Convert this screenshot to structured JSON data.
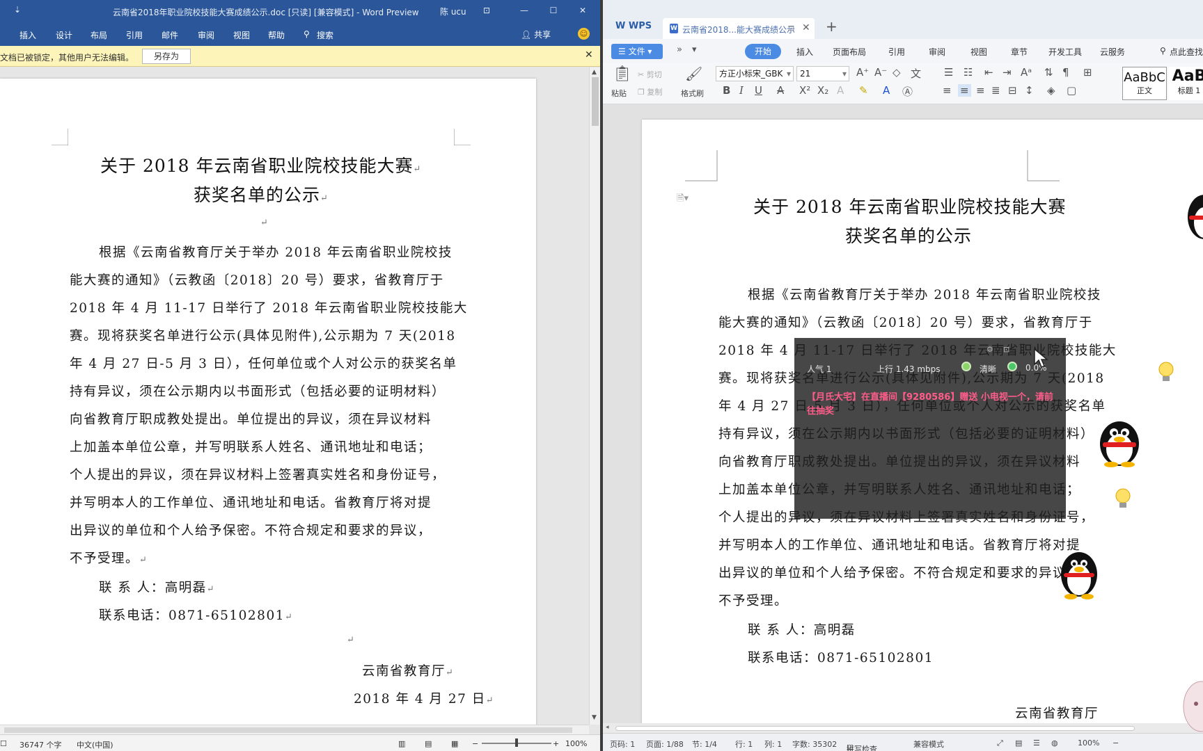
{
  "word": {
    "title": "云南省2018年职业院校技能大赛成绩公示.doc [只读] [兼容模式] - Word Preview",
    "user": "陈 ucu",
    "qa_symbol": "⇣",
    "ribbon_tabs": [
      "插入",
      "设计",
      "布局",
      "引用",
      "邮件",
      "审阅",
      "视图",
      "帮助",
      "搜索"
    ],
    "share_label": "共享",
    "infobar_message": "文档已被锁定，其他用户无法编辑。",
    "infobar_button": "另存为",
    "status": {
      "word_count": "36747 个字",
      "language": "中文(中国)",
      "zoom": "100%"
    }
  },
  "document": {
    "title_line1": "关于 2018 年云南省职业院校技能大赛",
    "title_line2": "获奖名单的公示",
    "paragraph_lines": [
      "根据《云南省教育厅关于举办 2018 年云南省职业院校技",
      "能大赛的通知》（云教函〔2018〕20 号）要求，省教育厅于",
      "2018 年 4 月 11-17 日举行了 2018 年云南省职业院校技能大",
      "赛。现将获奖名单进行公示(具体见附件),公示期为 7 天(2018",
      "年 4 月 27 日-5 月 3 日），任何单位或个人对公示的获奖名单",
      "持有异议，须在公示期内以书面形式（包括必要的证明材料）",
      "向省教育厅职成教处提出。单位提出的异议，须在异议材料",
      "上加盖本单位公章，并写明联系人姓名、通讯地址和电话；",
      "个人提出的异议，须在异议材料上签署真实姓名和身份证号，",
      "并写明本人的工作单位、通讯地址和电话。省教育厅将对提",
      "出异议的单位和个人给予保密。不符合规定和要求的异议，",
      "不予受理。"
    ],
    "contact_person": "联  系  人：高明磊",
    "contact_phone": "联系电话：0871-65102801",
    "signature": "云南省教育厅",
    "date": "2018 年 4 月 27 日"
  },
  "wps": {
    "logo": "WPS",
    "doc_tab": "云南省2018...能大赛成绩公示",
    "file_menu": "文件",
    "menu_items": [
      "开始",
      "插入",
      "页面布局",
      "引用",
      "审阅",
      "视图",
      "章节",
      "开发工具",
      "云服务"
    ],
    "search_label": "点此查找",
    "font_name": "方正小标宋_GBK",
    "font_size": "21",
    "tool_labels": {
      "paste": "粘贴",
      "cut": "剪切",
      "copy": "复制",
      "format_painter": "格式刷"
    },
    "styles": [
      "AaBbC",
      "正文",
      "AaB",
      "标题 1"
    ],
    "status": {
      "page_num": "页码: 1",
      "page_count": "页面: 1/88",
      "section": "节: 1/4",
      "row": "行: 1",
      "col": "列: 1",
      "word_count": "字数: 35302",
      "spellcheck": "拼写检查",
      "compat": "兼容模式",
      "zoom": "100%"
    }
  },
  "overlay": {
    "popularity": "人气  1",
    "upload": "上行  1.43 mbps",
    "quality": "清晰",
    "loss": "0.0%",
    "gift_message": "【月氏大宅】在直播间【9280586】赠送 小电视一个，请前往抽奖"
  },
  "colors": {
    "word_blue": "#2b579a",
    "wps_blue": "#4b8be3",
    "gift_pink": "#ff5c8a"
  }
}
